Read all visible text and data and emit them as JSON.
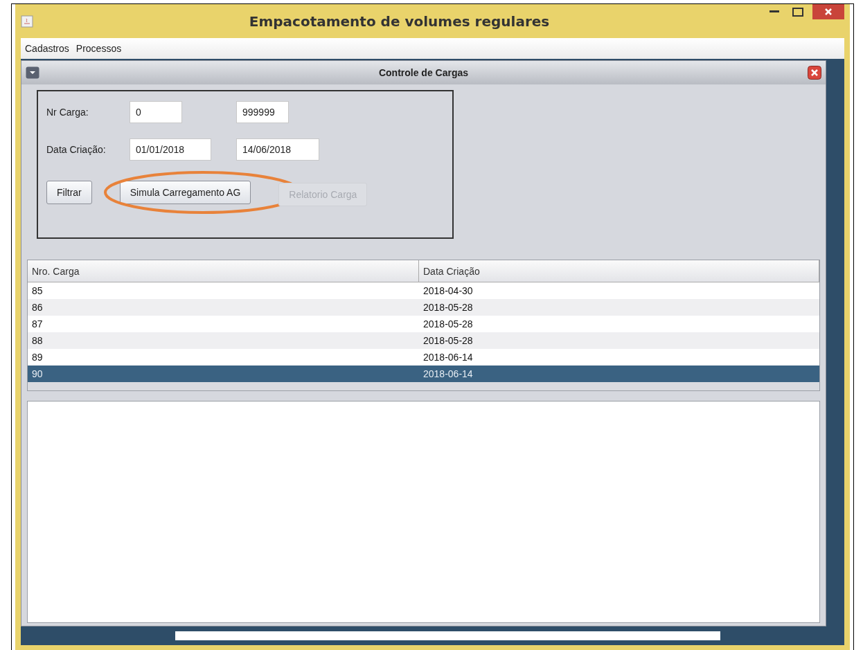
{
  "window": {
    "title": "Empacotamento de volumes regulares"
  },
  "menu": [
    "Cadastros",
    "Processos"
  ],
  "internal_frame": {
    "title": "Controle de Cargas"
  },
  "filter": {
    "rows": [
      {
        "label": "Nr Carga:",
        "from": "0",
        "to": "999999"
      },
      {
        "label": "Data Criação:",
        "from": "01/01/2018",
        "to": "14/06/2018"
      }
    ],
    "buttons": [
      {
        "label": "Filtrar",
        "disabled": false,
        "highlighted": false
      },
      {
        "label": "Simula Carregamento AG",
        "disabled": false,
        "highlighted": true
      },
      {
        "label": "Relatorio Carga",
        "disabled": true,
        "highlighted": false
      }
    ]
  },
  "table": {
    "columns": [
      "Nro. Carga",
      "Data Criação"
    ],
    "rows": [
      {
        "cells": [
          "85",
          "2018-04-30"
        ],
        "selected": false
      },
      {
        "cells": [
          "86",
          "2018-05-28"
        ],
        "selected": false
      },
      {
        "cells": [
          "87",
          "2018-05-28"
        ],
        "selected": false
      },
      {
        "cells": [
          "88",
          "2018-05-28"
        ],
        "selected": false
      },
      {
        "cells": [
          "89",
          "2018-06-14"
        ],
        "selected": false
      },
      {
        "cells": [
          "90",
          "2018-06-14"
        ],
        "selected": true
      }
    ]
  }
}
